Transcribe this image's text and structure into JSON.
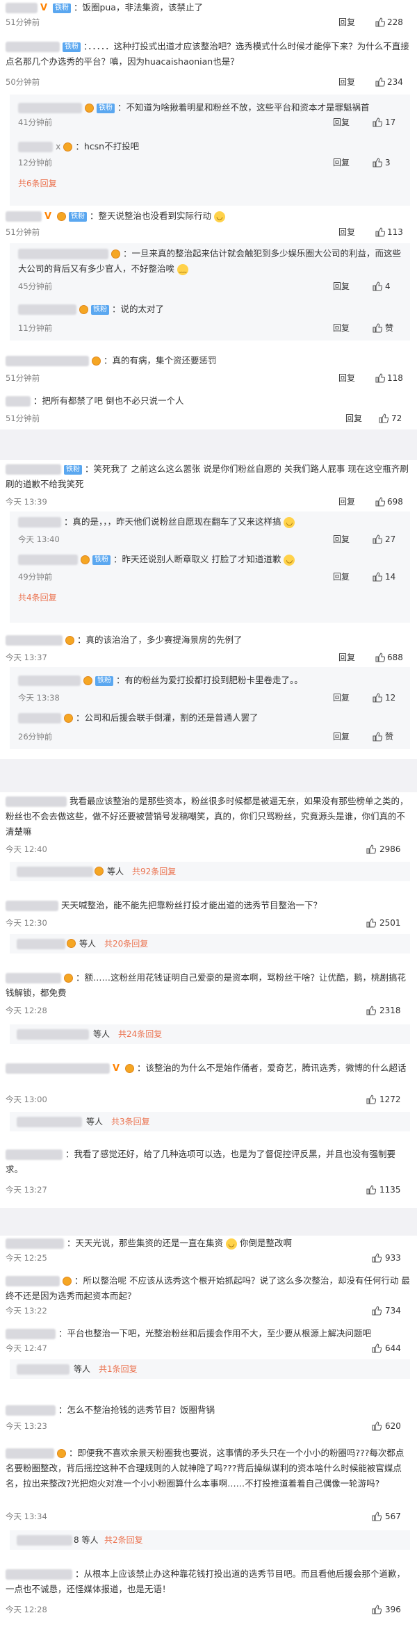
{
  "labels": {
    "reply": "回复",
    "praise": "赞",
    "etc": "等人",
    "tie": "铁粉"
  },
  "colors": {
    "link": "#eb7350",
    "badge_blue": "#5aa7f0",
    "vip_orange": "#ff8200",
    "muted": "#808080",
    "sub_bg": "#f6f7f9",
    "sep": "#f2f2f5"
  },
  "sec1": {
    "c1": {
      "text": "：饭圈pua，非法集资，该禁止了",
      "time": "51分钟前",
      "likes": "228"
    },
    "c2": {
      "text": "：．．．．．这种打投式出道才应该整治吧？选秀模式什么时候才能停下来？为什么不直接点名那几个办选秀的平台？嗔，因为huacaishaonian也是？",
      "time": "50分钟前",
      "likes": "234",
      "r1": {
        "text": "：不知道为啥揪着明星和粉丝不放，这些平台和资本才是罪魁祸首",
        "time": "41分钟前",
        "likes": "17"
      },
      "r2": {
        "text": "：hcsn不打投吧",
        "time": "12分钟前",
        "likes": "3"
      },
      "more": "共6条回复"
    },
    "c3": {
      "text": "：整天说整治也没看到实际行动",
      "time": "51分钟前",
      "likes": "113",
      "r1": {
        "text": "：一旦来真的整治起来估计就会触犯到多少娱乐圈大公司的利益，而这些大公司的背后又有多少官人，不好整治唉",
        "time": "45分钟前",
        "likes": "4"
      },
      "r2": {
        "text": "：说的太对了",
        "time": "11分钟前"
      }
    },
    "c4": {
      "text": "：真的有病，集个资还要惩罚",
      "time": "51分钟前",
      "likes": "118"
    },
    "c5": {
      "text": "：把所有都禁了吧 倒也不必只说一个人",
      "time": "51分钟前",
      "likes": "72"
    }
  },
  "sec2": {
    "c1": {
      "text": "：笑死我了 之前这么这么嚣张 说是你们粉丝自愿的 关我们路人屁事 现在这空瓶齐刷刷的道歉不给我笑死",
      "time": "今天 13:39",
      "likes": "698",
      "r1": {
        "text": "：真的是，，，昨天他们说粉丝自愿现在翻车了又来这样搞",
        "time": "今天 13:40",
        "likes": "27"
      },
      "r2": {
        "text": "：昨天还说别人断章取义 打脸了才知道道歉",
        "time": "49分钟前",
        "likes": "14"
      },
      "more": "共4条回复"
    },
    "c2": {
      "text": "：真的该治治了，多少赛提海景房的先例了",
      "time": "今天 13:37",
      "likes": "688",
      "r1": {
        "text": "：有的粉丝为爱打投都打投到肥粉卡里卷走了。。",
        "time": "今天 13:38",
        "likes": "12"
      },
      "r2": {
        "text": "：公司和后援会联手倒灌，割的还是普通人罢了",
        "time": "26分钟前"
      }
    }
  },
  "sec3": {
    "c1": {
      "text": "我看最应该整治的是那些资本，粉丝很多时候都是被逼无奈，如果没有那些榜单之类的，粉丝也不会去做这些，做不好还要被营销号发稿嘲笑，真的，你们只骂粉丝，究竟源头是谁，你们真的不清楚嘛",
      "time": "今天 12:40",
      "likes": "2986",
      "more": "共92条回复"
    },
    "c2": {
      "text": "天天喊整治，能不能先把靠粉丝打投才能出道的选秀节目整治一下？",
      "time": "今天 12:30",
      "likes": "2501",
      "more": "共20条回复"
    },
    "c3": {
      "text": "：额……这粉丝用花钱证明自己爱豪的是资本啊，骂粉丝干啥？让优酷，鹅，桃剧搞花钱解锁，都免费",
      "time": "今天 12:28",
      "likes": "2318",
      "more": "共24条回复"
    },
    "c4": {
      "text": "：该整治的为什么不是始作俑者，爱奇艺，腾讯选秀，微博的什么超话",
      "time": "今天 13:00",
      "likes": "1272",
      "more": "共3条回复"
    },
    "c5": {
      "text": "：我看了感觉还好，给了几种选项可以选，也是为了督促控评反黑，并且也没有强制要求。",
      "time": "今天 13:27",
      "likes": "1135"
    }
  },
  "sec4": {
    "c1": {
      "text": "：天天光说，那些集资的还是一直在集资",
      "text2": "你倒是整改啊",
      "time": "今天 12:25",
      "likes": "933"
    },
    "c2": {
      "text": "：所以整治呢 不应该从选秀这个根开始抓起吗？说了这么多次整治，却没有任何行动 最终不还是因为选秀而起资本而起？",
      "time": "今天 13:22",
      "likes": "734"
    },
    "c3": {
      "text": "：平台也整治一下吧，光整治粉丝和后援会作用不大，至少要从根源上解决问题吧",
      "time": "今天 12:47",
      "likes": "644",
      "more": "共1条回复"
    },
    "c4": {
      "text": "：怎么不整治抢钱的选秀节目？饭圈背锅",
      "time": "今天 13:23",
      "likes": "620"
    },
    "c5": {
      "text": "：即便我不喜欢余景天粉圈我也要说，这事情的矛头只在一个小小的粉圈吗???每次都点名要粉圈整改，背后摇控这种不合理规则的人就神隐了吗???背后操纵谋利的资本啥什么时候能被官媒点名，拉出来整改?光把炮火对准一个小小粉圈算什么本事啊……不打投推道着着自己偶像一轮游吗?",
      "time": "今天 13:34",
      "likes": "567",
      "more_prefix": "8 等人",
      "more": "共2条回复"
    },
    "c6": {
      "text": "：从根本上应该禁止办这种靠花钱打投出道的选秀节目吧。而且看他后援会那个道歉，一点也不诚恳，还怪媒体报道，也是无语！",
      "time": "今天 12:28",
      "likes": "396"
    }
  }
}
